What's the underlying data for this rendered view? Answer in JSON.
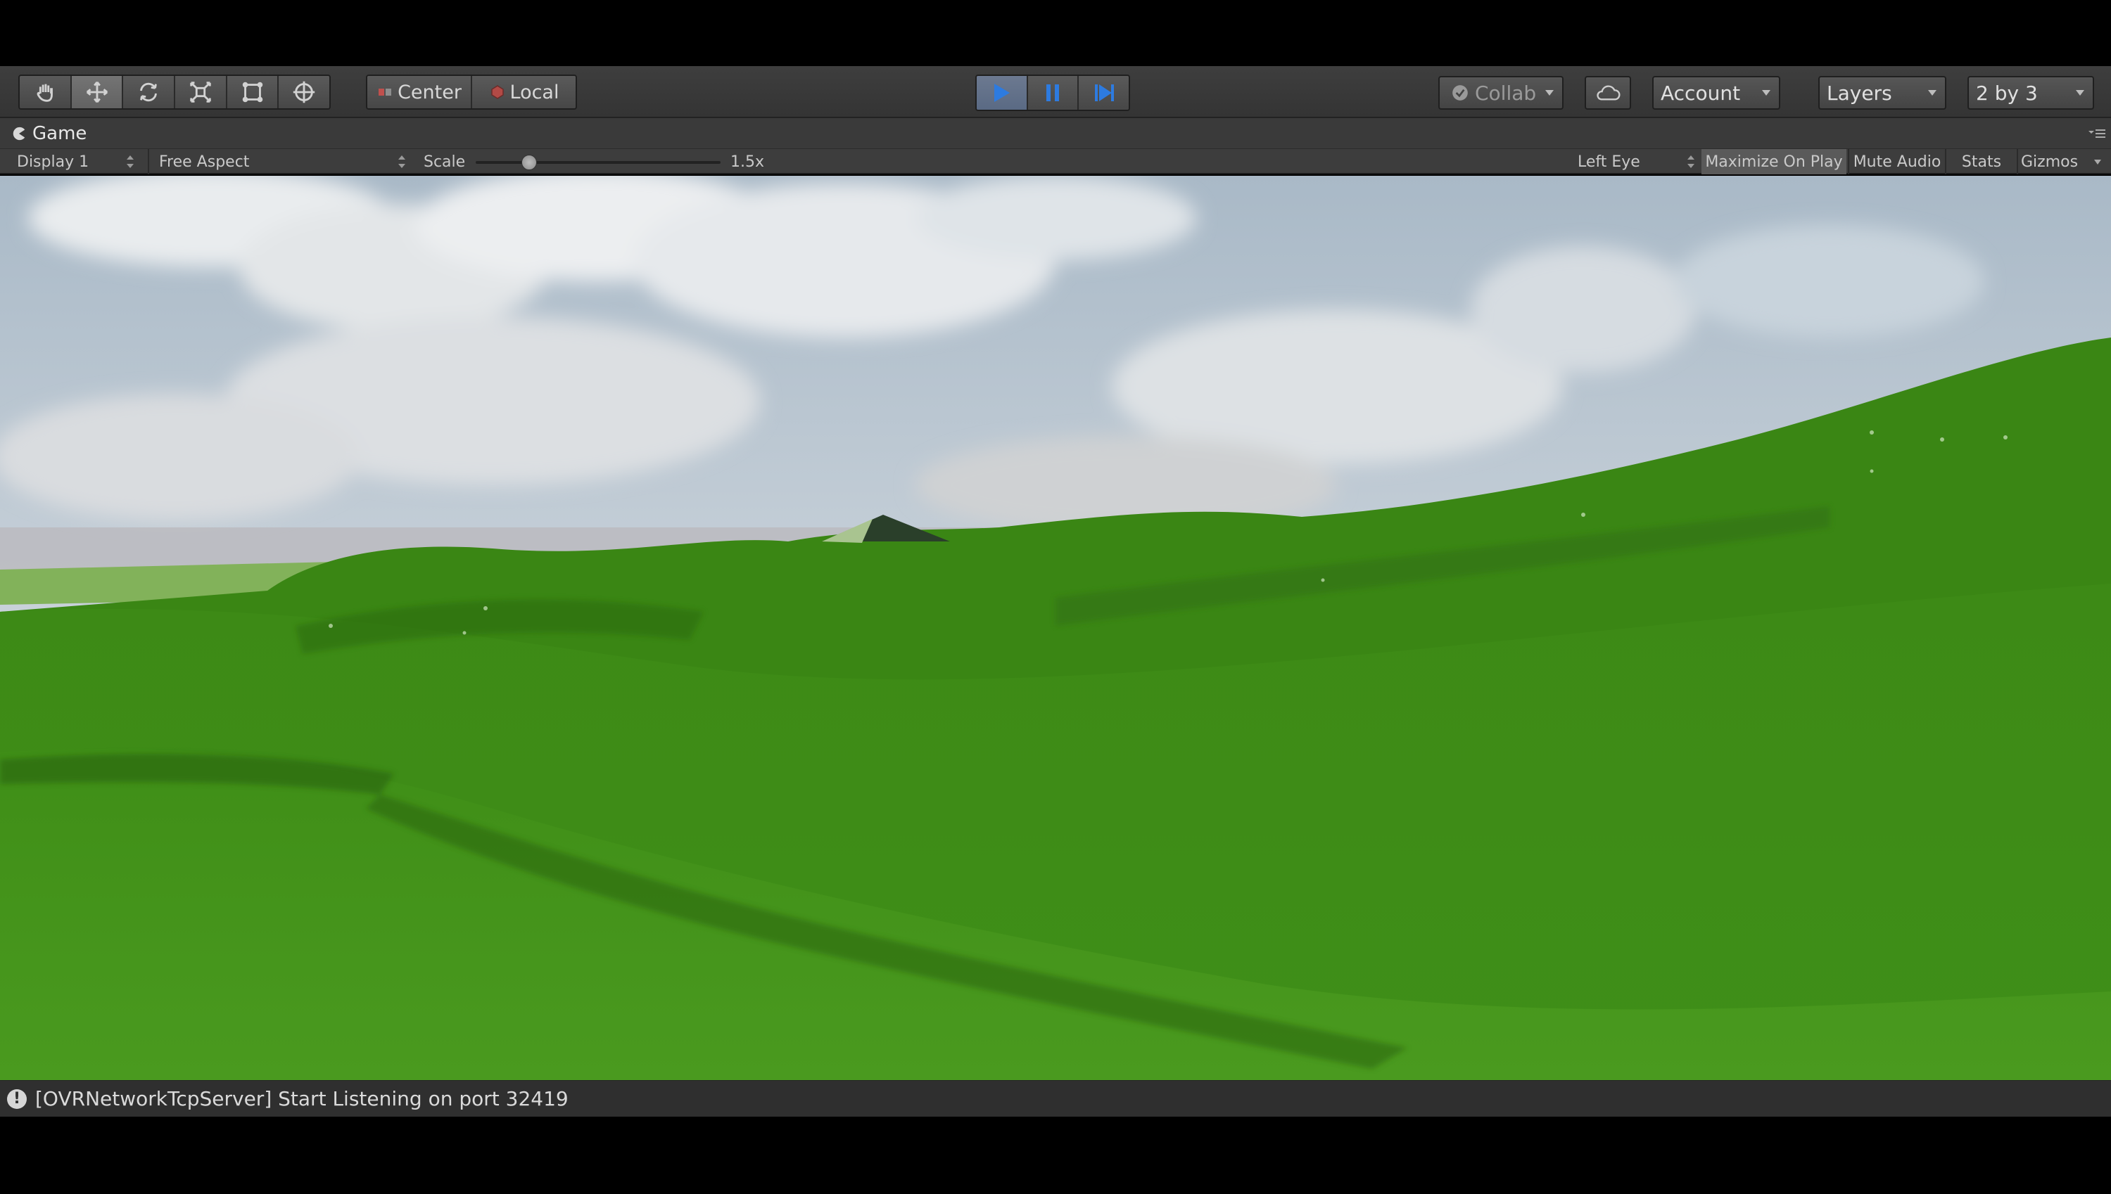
{
  "toolbar": {
    "tools": [
      {
        "name": "hand-tool-icon",
        "active": false
      },
      {
        "name": "move-tool-icon",
        "active": true
      },
      {
        "name": "rotate-tool-icon",
        "active": false
      },
      {
        "name": "scale-tool-icon",
        "active": false
      },
      {
        "name": "rect-tool-icon",
        "active": false
      },
      {
        "name": "transform-tool-icon",
        "active": false
      }
    ],
    "pivot_label": "Center",
    "space_label": "Local",
    "collab_label": "Collab",
    "account_label": "Account",
    "layers_label": "Layers",
    "layout_label": "2 by 3",
    "play_state": "playing"
  },
  "game_panel": {
    "tab_label": "Game",
    "display_label": "Display 1",
    "aspect_label": "Free Aspect",
    "scale_label": "Scale",
    "scale_value": "1.5x",
    "scale_fraction": 0.2,
    "eye_label": "Left Eye",
    "maximize_label": "Maximize On Play",
    "mute_label": "Mute Audio",
    "stats_label": "Stats",
    "gizmos_label": "Gizmos"
  },
  "status": {
    "message": "[OVRNetworkTcpServer] Start Listening on port 32419"
  },
  "colors": {
    "accent_play": "#2d7be0",
    "grass_dark": "#2f6e10",
    "grass_light": "#4f9d20",
    "sky": "#c9d4dc"
  }
}
